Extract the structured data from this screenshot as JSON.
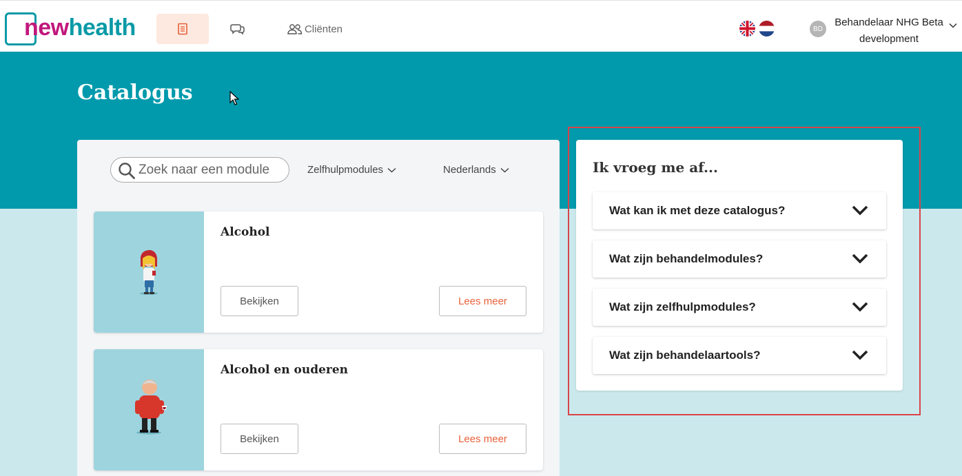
{
  "brand": {
    "name_part1": "new",
    "name_part2": "health",
    "color_magenta": "#c1177c",
    "color_teal": "#0a9aa6"
  },
  "nav": {
    "catalog_icon": "book-icon",
    "chat_icon": "chat-bubbles-icon",
    "clients_label": "Cliënten",
    "clients_icon": "users-icon"
  },
  "languages": [
    "en",
    "nl"
  ],
  "user": {
    "initials": "BD",
    "name": "Behandelaar NHG Beta development"
  },
  "page": {
    "title": "Catalogus"
  },
  "filters": {
    "search_placeholder": "Zoek naar een module",
    "type_label": "Zelfhulpmodules",
    "language_label": "Nederlands"
  },
  "modules": [
    {
      "title": "Alcohol",
      "view_label": "Bekijken",
      "more_label": "Lees meer"
    },
    {
      "title": "Alcohol en ouderen",
      "view_label": "Bekijken",
      "more_label": "Lees meer"
    }
  ],
  "faq": {
    "title": "Ik vroeg me af...",
    "items": [
      {
        "question": "Wat kan ik met deze catalogus?"
      },
      {
        "question": "Wat zijn behandelmodules?"
      },
      {
        "question": "Wat zijn zelfhulpmodules?"
      },
      {
        "question": "Wat zijn behandelaartools?"
      }
    ]
  },
  "colors": {
    "hero": "#009aac",
    "background": "#cbe9ec",
    "accent": "#e8613a",
    "highlight": "#d9434a"
  }
}
